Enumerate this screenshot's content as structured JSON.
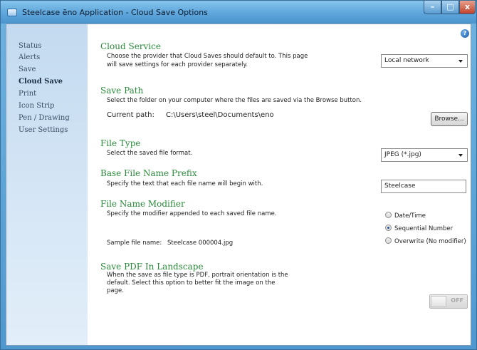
{
  "window": {
    "title": "Steelcase ēno Application - Cloud Save Options"
  },
  "controls": {
    "minimize": "–",
    "maximize": "□",
    "close": "x",
    "help": "?"
  },
  "sidebar": {
    "items": [
      {
        "label": "Status"
      },
      {
        "label": "Alerts"
      },
      {
        "label": "Save"
      },
      {
        "label": "Cloud Save",
        "active": true
      },
      {
        "label": "Print"
      },
      {
        "label": "Icon Strip"
      },
      {
        "label": "Pen / Drawing"
      },
      {
        "label": "User Settings"
      }
    ]
  },
  "cloud_service": {
    "title": "Cloud Service",
    "desc_line1": "Choose the provider that Cloud Saves should default to. This page",
    "desc_line2": "will save settings for each provider separately.",
    "selected": "Local network"
  },
  "save_path": {
    "title": "Save Path",
    "desc": "Select the folder on your computer where the files are saved via the Browse button.",
    "current_label": "Current path:",
    "current_value": "C:\\Users\\steel\\Documents\\eno",
    "browse_label": "Browse..."
  },
  "file_type": {
    "title": "File Type",
    "desc": "Select the saved file format.",
    "selected": "JPEG (*.jpg)"
  },
  "base_prefix": {
    "title": "Base File Name Prefix",
    "desc": "Specify the text that each file name will begin with.",
    "value": "Steelcase"
  },
  "modifier": {
    "title": "File Name Modifier",
    "desc": "Specify the modifier appended to each saved file name.",
    "sample_label": "Sample file name:",
    "sample_value": "Steelcase 000004.jpg",
    "options": [
      {
        "label": "Date/Time",
        "checked": false
      },
      {
        "label": "Sequential Number",
        "checked": true
      },
      {
        "label": "Overwrite (No modifier)",
        "checked": false
      }
    ]
  },
  "pdf_landscape": {
    "title": "Save PDF In Landscape",
    "desc_line1": "When the save as file type is PDF, portrait orientation is the",
    "desc_line2": "default. Select this option to better fit the image on the",
    "desc_line3": "page.",
    "toggle_label": "OFF"
  }
}
